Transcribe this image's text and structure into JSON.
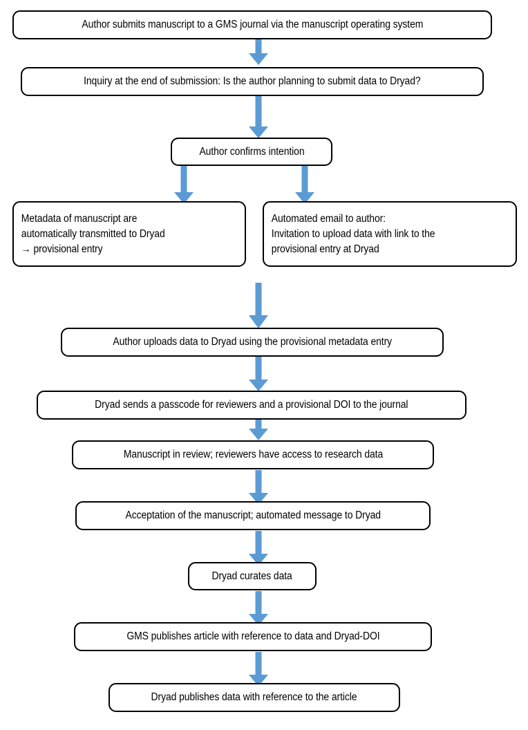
{
  "diagram": {
    "title": "Workflow for data submission to Dryad from a GMS journal",
    "type": "flowchart",
    "orientation": "top-to-bottom",
    "arrow_color": "#5B9BD5",
    "box_border_color": "#000000",
    "box_fill_color": "#FFFFFF",
    "text_color": "#000000"
  },
  "nodes": [
    {
      "id": "n1",
      "label": "Author submits manuscript to a GMS journal via the manuscript operating system",
      "align": "center"
    },
    {
      "id": "n2",
      "label": "Inquiry at the end of submission: Is the author planning to submit data to Dryad?",
      "align": "center"
    },
    {
      "id": "n3",
      "label": "Author confirms intention",
      "align": "center"
    },
    {
      "id": "n4",
      "label": "Metadata of manuscript are\nautomatically transmitted to Dryad\n→ provisional entry",
      "align": "left"
    },
    {
      "id": "n5",
      "label": "Automated email to author:\nInvitation to upload data with link to the\nprovisional entry at Dryad",
      "align": "left"
    },
    {
      "id": "n6",
      "label": "Author uploads data to Dryad using the provisional metadata entry",
      "align": "center"
    },
    {
      "id": "n7",
      "label": "Dryad sends a passcode for reviewers and a provisional DOI to the journal",
      "align": "center"
    },
    {
      "id": "n8",
      "label": "Manuscript in review; reviewers have access to research data",
      "align": "center"
    },
    {
      "id": "n9",
      "label": "Acceptation of the manuscript; automated message to Dryad",
      "align": "center"
    },
    {
      "id": "n10",
      "label": "Dryad curates data",
      "align": "center"
    },
    {
      "id": "n11",
      "label": "GMS publishes article with reference to data and Dryad-DOI",
      "align": "center"
    },
    {
      "id": "n12",
      "label": "Dryad publishes data with reference to the article",
      "align": "center"
    }
  ],
  "connectors": [
    {
      "id": "a1",
      "from": "n1",
      "to": "n2",
      "icon": "down-arrow-icon"
    },
    {
      "id": "a2",
      "from": "n2",
      "to": "n3",
      "icon": "down-arrow-icon"
    },
    {
      "id": "a3",
      "from": "n3",
      "to": "n4",
      "icon": "down-arrow-icon"
    },
    {
      "id": "a4",
      "from": "n3",
      "to": "n5",
      "icon": "down-arrow-icon"
    },
    {
      "id": "a5",
      "from": "n4",
      "to": "n6",
      "icon": "down-arrow-icon"
    },
    {
      "id": "a6",
      "from": "n6",
      "to": "n7",
      "icon": "down-arrow-icon"
    },
    {
      "id": "a7",
      "from": "n7",
      "to": "n8",
      "icon": "down-arrow-icon"
    },
    {
      "id": "a8",
      "from": "n8",
      "to": "n9",
      "icon": "down-arrow-icon"
    },
    {
      "id": "a9",
      "from": "n9",
      "to": "n10",
      "icon": "down-arrow-icon"
    },
    {
      "id": "a10",
      "from": "n10",
      "to": "n11",
      "icon": "down-arrow-icon"
    },
    {
      "id": "a11",
      "from": "n11",
      "to": "n12",
      "icon": "down-arrow-icon"
    }
  ]
}
